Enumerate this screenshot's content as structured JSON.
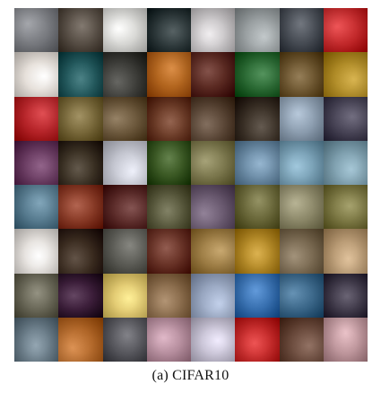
{
  "figure": {
    "caption": "(a) CIFAR10"
  },
  "sample_grid": {
    "rows": 8,
    "cols": 8,
    "tiles": [
      [
        "#7d7f84",
        "#5a5148",
        "#d9d9d6",
        "#2f3a3c",
        "#c9c6c8",
        "#9aa0a2",
        "#4a4f57",
        "#c62d2f"
      ],
      [
        "#e6e0da",
        "#245a5e",
        "#3e3e3a",
        "#b3661f",
        "#5b2a22",
        "#2c6b35",
        "#6d5630",
        "#b08c28"
      ],
      [
        "#b8262b",
        "#7a6a3c",
        "#6e5a3e",
        "#6c3c28",
        "#5a4636",
        "#3c3228",
        "#8fa0b2",
        "#4a4658"
      ],
      [
        "#6a3c62",
        "#3b3124",
        "#c6c8d2",
        "#3c5a25",
        "#7e7a50",
        "#6e8ea8",
        "#79a0b5",
        "#7e9fae"
      ],
      [
        "#5a7e92",
        "#8a3c28",
        "#5c2c2a",
        "#5a5a3e",
        "#6a5a70",
        "#6c6a3c",
        "#8f8b6c",
        "#7e7a46"
      ],
      [
        "#e4e0dc",
        "#3a2b1f",
        "#5e5e58",
        "#6a3428",
        "#a08048",
        "#b48a28",
        "#7a6a52",
        "#b89a74"
      ],
      [
        "#6c6a5a",
        "#3c1e3a",
        "#e0c870",
        "#8a6c4c",
        "#9aa8c2",
        "#3a72b2",
        "#3e6a8c",
        "#423c4c"
      ],
      [
        "#6c7e8a",
        "#b46a2c",
        "#5a5a60",
        "#b890a0",
        "#c9c4d6",
        "#c62c2c",
        "#6a4a3c",
        "#c29aa0"
      ]
    ]
  }
}
